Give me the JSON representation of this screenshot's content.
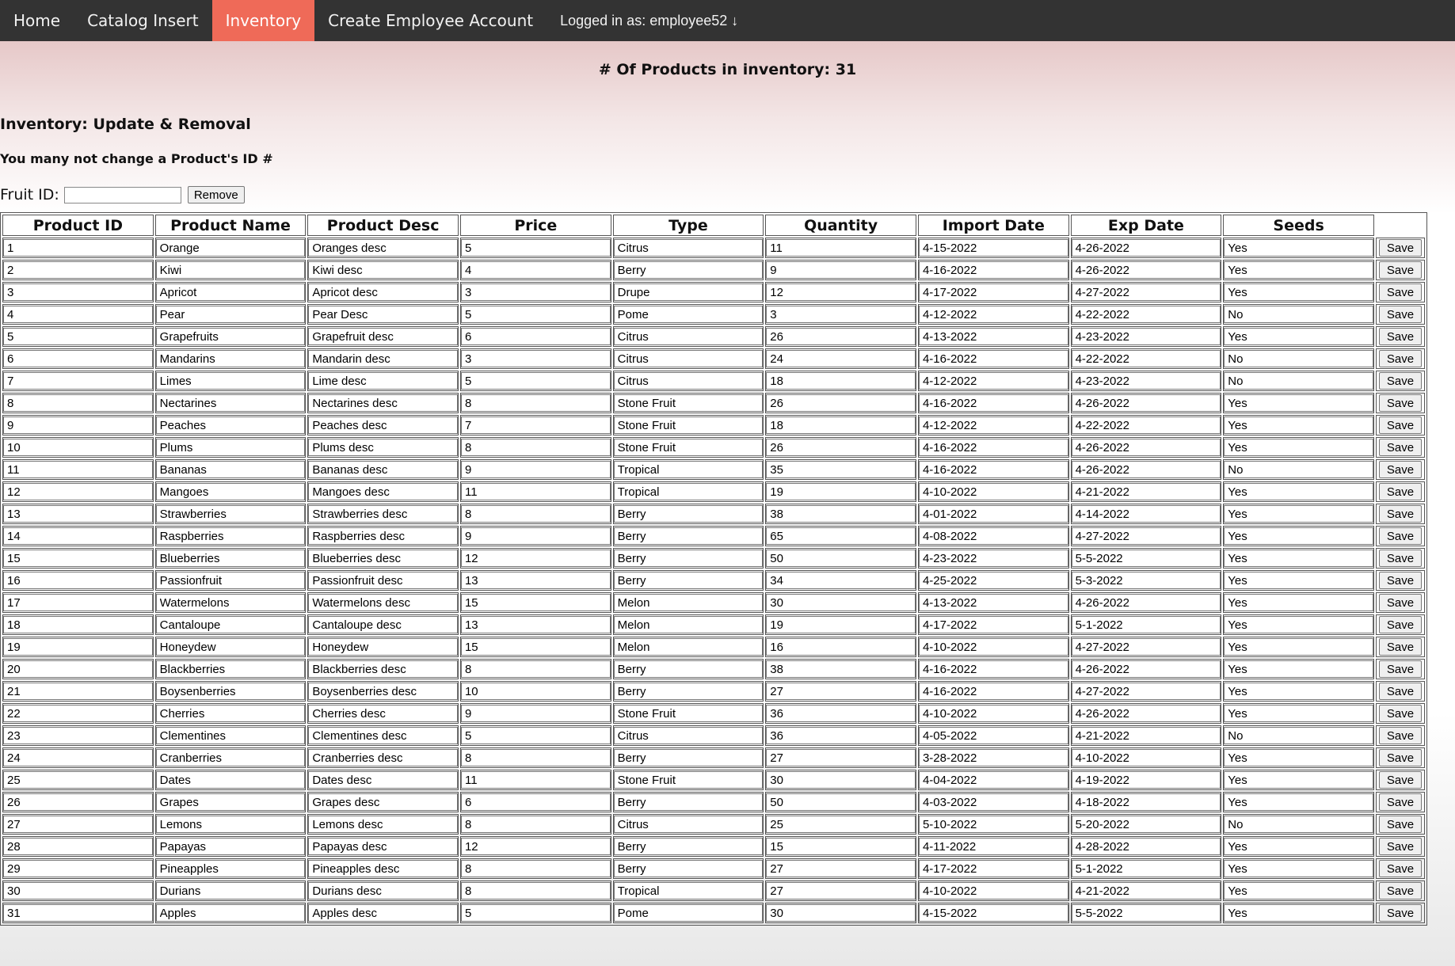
{
  "nav": {
    "home": "Home",
    "catalog_insert": "Catalog Insert",
    "inventory": "Inventory",
    "create_employee": "Create Employee Account",
    "logged_in": "Logged in as: employee52 ↓"
  },
  "summary": {
    "count_label": "# Of Products in inventory:",
    "count_value": "31"
  },
  "section": {
    "title": "Inventory: Update & Removal",
    "note": "You many not change a Product's ID #"
  },
  "remove": {
    "label": "Fruit ID:",
    "value": "",
    "button": "Remove"
  },
  "table": {
    "headers": [
      "Product ID",
      "Product Name",
      "Product Desc",
      "Price",
      "Type",
      "Quantity",
      "Import Date",
      "Exp Date",
      "Seeds"
    ],
    "save_label": "Save",
    "rows": [
      [
        "1",
        "Orange",
        "Oranges desc",
        "5",
        "Citrus",
        "11",
        "4-15-2022",
        "4-26-2022",
        "Yes"
      ],
      [
        "2",
        "Kiwi",
        "Kiwi desc",
        "4",
        "Berry",
        "9",
        "4-16-2022",
        "4-26-2022",
        "Yes"
      ],
      [
        "3",
        "Apricot",
        "Apricot desc",
        "3",
        "Drupe",
        "12",
        "4-17-2022",
        "4-27-2022",
        "Yes"
      ],
      [
        "4",
        "Pear",
        "Pear Desc",
        "5",
        "Pome",
        "3",
        "4-12-2022",
        "4-22-2022",
        "No"
      ],
      [
        "5",
        "Grapefruits",
        "Grapefruit desc",
        "6",
        "Citrus",
        "26",
        "4-13-2022",
        "4-23-2022",
        "Yes"
      ],
      [
        "6",
        "Mandarins",
        "Mandarin desc",
        "3",
        "Citrus",
        "24",
        "4-16-2022",
        "4-22-2022",
        "No"
      ],
      [
        "7",
        "Limes",
        "Lime desc",
        "5",
        "Citrus",
        "18",
        "4-12-2022",
        "4-23-2022",
        "No"
      ],
      [
        "8",
        "Nectarines",
        "Nectarines desc",
        "8",
        "Stone Fruit",
        "26",
        "4-16-2022",
        "4-26-2022",
        "Yes"
      ],
      [
        "9",
        "Peaches",
        "Peaches desc",
        "7",
        "Stone Fruit",
        "18",
        "4-12-2022",
        "4-22-2022",
        "Yes"
      ],
      [
        "10",
        "Plums",
        "Plums desc",
        "8",
        "Stone Fruit",
        "26",
        "4-16-2022",
        "4-26-2022",
        "Yes"
      ],
      [
        "11",
        "Bananas",
        "Bananas desc",
        "9",
        "Tropical",
        "35",
        "4-16-2022",
        "4-26-2022",
        "No"
      ],
      [
        "12",
        "Mangoes",
        "Mangoes desc",
        "11",
        "Tropical",
        "19",
        "4-10-2022",
        "4-21-2022",
        "Yes"
      ],
      [
        "13",
        "Strawberries",
        "Strawberries desc",
        "8",
        "Berry",
        "38",
        "4-01-2022",
        "4-14-2022",
        "Yes"
      ],
      [
        "14",
        "Raspberries",
        "Raspberries desc",
        "9",
        "Berry",
        "65",
        "4-08-2022",
        "4-27-2022",
        "Yes"
      ],
      [
        "15",
        "Blueberries",
        "Blueberries desc",
        "12",
        "Berry",
        "50",
        "4-23-2022",
        "5-5-2022",
        "Yes"
      ],
      [
        "16",
        "Passionfruit",
        "Passionfruit desc",
        "13",
        "Berry",
        "34",
        "4-25-2022",
        "5-3-2022",
        "Yes"
      ],
      [
        "17",
        "Watermelons",
        "Watermelons desc",
        "15",
        "Melon",
        "30",
        "4-13-2022",
        "4-26-2022",
        "Yes"
      ],
      [
        "18",
        "Cantaloupe",
        "Cantaloupe desc",
        "13",
        "Melon",
        "19",
        "4-17-2022",
        "5-1-2022",
        "Yes"
      ],
      [
        "19",
        "Honeydew",
        "Honeydew",
        "15",
        "Melon",
        "16",
        "4-10-2022",
        "4-27-2022",
        "Yes"
      ],
      [
        "20",
        "Blackberries",
        "Blackberries desc",
        "8",
        "Berry",
        "38",
        "4-16-2022",
        "4-26-2022",
        "Yes"
      ],
      [
        "21",
        "Boysenberries",
        "Boysenberries desc",
        "10",
        "Berry",
        "27",
        "4-16-2022",
        "4-27-2022",
        "Yes"
      ],
      [
        "22",
        "Cherries",
        "Cherries desc",
        "9",
        "Stone Fruit",
        "36",
        "4-10-2022",
        "4-26-2022",
        "Yes"
      ],
      [
        "23",
        "Clementines",
        "Clementines desc",
        "5",
        "Citrus",
        "36",
        "4-05-2022",
        "4-21-2022",
        "No"
      ],
      [
        "24",
        "Cranberries",
        "Cranberries desc",
        "8",
        "Berry",
        "27",
        "3-28-2022",
        "4-10-2022",
        "Yes"
      ],
      [
        "25",
        "Dates",
        "Dates desc",
        "11",
        "Stone Fruit",
        "30",
        "4-04-2022",
        "4-19-2022",
        "Yes"
      ],
      [
        "26",
        "Grapes",
        "Grapes desc",
        "6",
        "Berry",
        "50",
        "4-03-2022",
        "4-18-2022",
        "Yes"
      ],
      [
        "27",
        "Lemons",
        "Lemons desc",
        "8",
        "Citrus",
        "25",
        "5-10-2022",
        "5-20-2022",
        "No"
      ],
      [
        "28",
        "Papayas",
        "Papayas desc",
        "12",
        "Berry",
        "15",
        "4-11-2022",
        "4-28-2022",
        "Yes"
      ],
      [
        "29",
        "Pineapples",
        "Pineapples desc",
        "8",
        "Berry",
        "27",
        "4-17-2022",
        "5-1-2022",
        "Yes"
      ],
      [
        "30",
        "Durians",
        "Durians desc",
        "8",
        "Tropical",
        "27",
        "4-10-2022",
        "4-21-2022",
        "Yes"
      ],
      [
        "31",
        "Apples",
        "Apples desc",
        "5",
        "Pome",
        "30",
        "4-15-2022",
        "5-5-2022",
        "Yes"
      ]
    ]
  },
  "colors": {
    "nav_bg": "#333333",
    "nav_active": "#ef6a58",
    "header_gradient_top": "#dfb8b8"
  }
}
